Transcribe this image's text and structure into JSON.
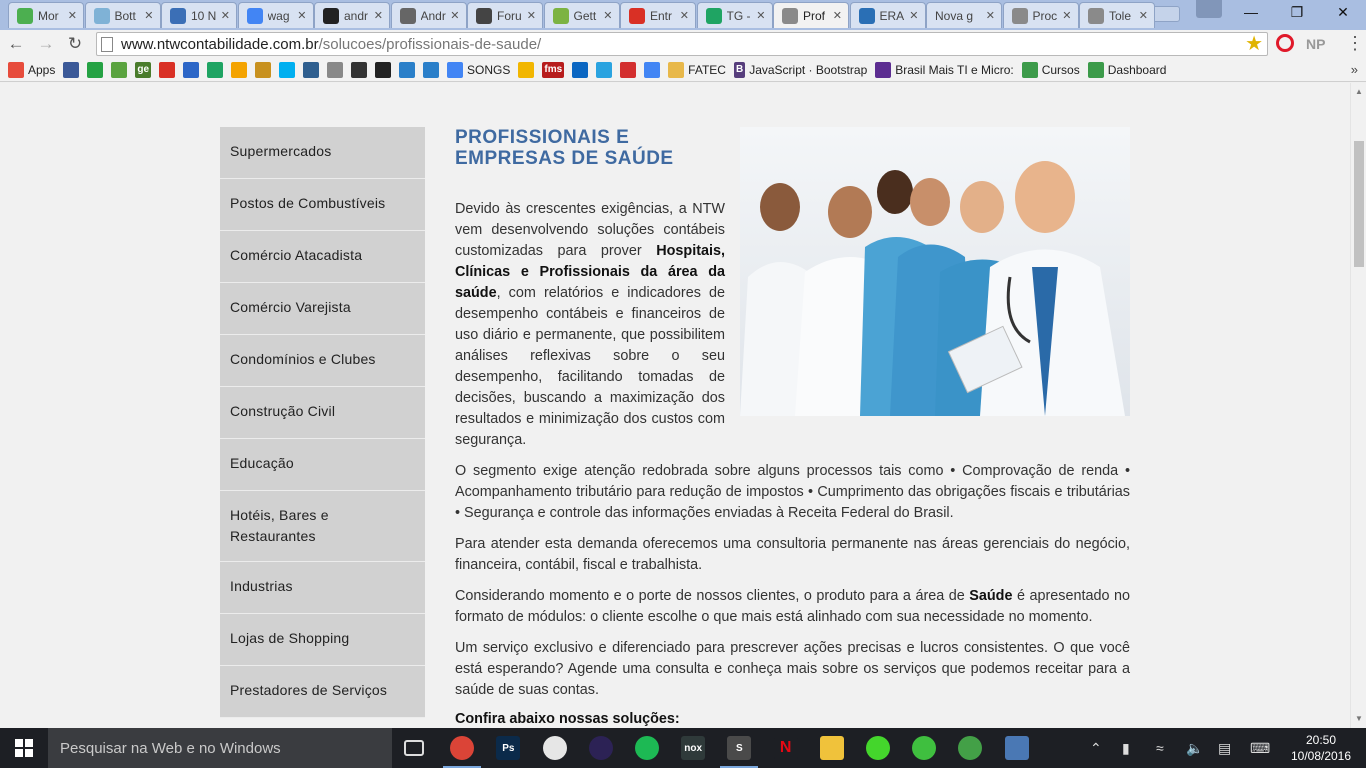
{
  "browser": {
    "tabs": [
      {
        "label": "Mor",
        "icon": "leaf-icon",
        "color": "#4caf50"
      },
      {
        "label": "Bott",
        "icon": "bottle-icon",
        "color": "#7fb2d6"
      },
      {
        "label": "10 N",
        "icon": "photo-icon",
        "color": "#3b6fb6"
      },
      {
        "label": "wag",
        "icon": "google-icon",
        "color": "#4285f4"
      },
      {
        "label": "andr",
        "icon": "github-icon",
        "color": "#222222"
      },
      {
        "label": "Andr",
        "icon": "wikipedia-icon",
        "color": "#666666"
      },
      {
        "label": "Foru",
        "icon": "forum-icon",
        "color": "#444444"
      },
      {
        "label": "Gett",
        "icon": "android-icon",
        "color": "#7cb342"
      },
      {
        "label": "Entr",
        "icon": "gmail-icon",
        "color": "#d93025"
      },
      {
        "label": "TG -",
        "icon": "drive-icon",
        "color": "#1fa463"
      },
      {
        "label": "Prof",
        "icon": "page-icon",
        "color": "#8a8a8a",
        "active": true
      },
      {
        "label": "ERA",
        "icon": "globe-icon",
        "color": "#2a6fb5"
      },
      {
        "label": "Nova g",
        "icon": "none",
        "color": "#d8e2f2"
      },
      {
        "label": "Proc",
        "icon": "page-icon",
        "color": "#8a8a8a"
      },
      {
        "label": "Tole",
        "icon": "page-icon",
        "color": "#8a8a8a"
      }
    ],
    "window_controls": {
      "minimize": "—",
      "maximize": "❐",
      "close": "✕"
    },
    "address": {
      "host": "www.ntwcontabilidade.com.br",
      "path": "/solucoes/profissionais-de-saude/"
    },
    "extensions": {
      "np_label": "NP"
    },
    "bookmarks": [
      {
        "label": "Apps",
        "icon": "apps-grid-icon",
        "color": "#e74c3c"
      },
      {
        "label": "",
        "icon": "facebook-icon",
        "color": "#3b5998"
      },
      {
        "label": "",
        "icon": "whatsapp-icon",
        "color": "#25a244"
      },
      {
        "label": "",
        "icon": "evernote-icon",
        "color": "#5aa33f"
      },
      {
        "label": "",
        "icon": "ge-icon",
        "color": "#4a7c2c",
        "glyph": "ge"
      },
      {
        "label": "",
        "icon": "gmail-icon",
        "color": "#d93025"
      },
      {
        "label": "",
        "icon": "mail-icon",
        "color": "#2c66c7"
      },
      {
        "label": "",
        "icon": "drive-icon",
        "color": "#1fa463"
      },
      {
        "label": "",
        "icon": "pinwheel-icon",
        "color": "#f4a300"
      },
      {
        "label": "",
        "icon": "lock-icon",
        "color": "#c8911f"
      },
      {
        "label": "",
        "icon": "skype-icon",
        "color": "#00aff0"
      },
      {
        "label": "",
        "icon": "photo-icon",
        "color": "#2f5f8f"
      },
      {
        "label": "",
        "icon": "bug-icon",
        "color": "#888888"
      },
      {
        "label": "",
        "icon": "chart-icon",
        "color": "#333333"
      },
      {
        "label": "",
        "icon": "git-icon",
        "color": "#222222"
      },
      {
        "label": "",
        "icon": "cloud-download-icon",
        "color": "#2a7fc9"
      },
      {
        "label": "",
        "icon": "download-icon",
        "color": "#2a7fc9"
      },
      {
        "label": "SONGS",
        "icon": "docs-icon",
        "color": "#4285f4"
      },
      {
        "label": "",
        "icon": "sun-icon",
        "color": "#f2b600"
      },
      {
        "label": "",
        "icon": "fms-icon",
        "color": "#b71c1c",
        "glyph": "fms"
      },
      {
        "label": "",
        "icon": "linkedin-icon",
        "color": "#0a66c2"
      },
      {
        "label": "",
        "icon": "play-icon",
        "color": "#2aa3e0"
      },
      {
        "label": "",
        "icon": "yahoo-icon",
        "color": "#d32f2f"
      },
      {
        "label": "",
        "icon": "translate-icon",
        "color": "#4285f4"
      },
      {
        "label": "FATEC",
        "icon": "folder-icon",
        "color": "#e8b84a"
      },
      {
        "label": "JavaScript · Bootstrap",
        "icon": "bootstrap-icon",
        "color": "#563d7c",
        "glyph": "B"
      },
      {
        "label": "Brasil Mais TI e Micro:",
        "icon": "microsoft-icon",
        "color": "#5c2d91"
      },
      {
        "label": "Cursos",
        "icon": "people-icon",
        "color": "#3c9b4a"
      },
      {
        "label": "Dashboard",
        "icon": "people-icon",
        "color": "#3c9b4a"
      }
    ],
    "bookmarks_more": "»"
  },
  "sidebar": {
    "items": [
      {
        "label": "Supermercados"
      },
      {
        "label": "Postos de Combustíveis"
      },
      {
        "label": "Comércio Atacadista"
      },
      {
        "label": "Comércio Varejista"
      },
      {
        "label": "Condomínios e Clubes"
      },
      {
        "label": "Construção Civil"
      },
      {
        "label": "Educação"
      },
      {
        "label": "Hotéis, Bares e Restaurantes"
      },
      {
        "label": "Industrias"
      },
      {
        "label": "Lojas de Shopping"
      },
      {
        "label": "Prestadores de Serviços"
      }
    ]
  },
  "main": {
    "title": "PROFISSIONAIS E EMPRESAS DE SAÚDE",
    "intro_before": "Devido às crescentes exigências, a NTW vem desenvolvendo soluções contábeis customizadas para prover ",
    "intro_bold": "Hospitais, Clínicas e Profissionais da área da saúde",
    "intro_after": ", com relatórios e indicadores de desempenho contábeis e financeiros de uso diário e permanente, que possibilitem análises reflexivas sobre o seu desempenho, facilitando tomadas de decisões, buscando a maximização dos resultados e minimização dos custos com segurança.",
    "para1": "O segmento exige atenção redobrada sobre alguns processos tais como • Comprovação de renda • Acompanhamento tributário para redução de impostos • Cumprimento das obrigações fiscais e tributárias • Segurança e controle das informações enviadas à Receita Federal do Brasil.",
    "para2": "Para atender esta demanda oferecemos uma consultoria permanente nas áreas gerenciais do negócio, financeira, contábil, fiscal e trabalhista.",
    "para3_before": "Considerando momento e o porte de nossos clientes, o produto para a área de ",
    "para3_bold": "Saúde",
    "para3_after": " é apresentado no formato de módulos:  o cliente escolhe o que mais está alinhado com sua necessidade no momento.",
    "para4": "Um serviço exclusivo e diferenciado para prescrever ações precisas e lucros consistentes. O que você está esperando? Agende uma consulta e conheça mais sobre os serviços que podemos receitar para a saúde de suas contas.",
    "confira": "Confira abaixo nossas soluções:"
  },
  "taskbar": {
    "search_placeholder": "Pesquisar na Web e no Windows",
    "apps": [
      {
        "icon": "task-view-icon",
        "color": "#1d1f24"
      },
      {
        "icon": "chrome-icon",
        "color": "#db4437",
        "active": true
      },
      {
        "icon": "photoshop-icon",
        "color": "#0b2a4a",
        "glyph": "Ps"
      },
      {
        "icon": "itunes-icon",
        "color": "#e6e6e6"
      },
      {
        "icon": "eclipse-icon",
        "color": "#2c2255"
      },
      {
        "icon": "spotify-icon",
        "color": "#1db954"
      },
      {
        "icon": "nox-icon",
        "color": "#2f3a3a",
        "glyph": "nox"
      },
      {
        "icon": "sublime-icon",
        "color": "#4a4a4a",
        "glyph": "S",
        "active": true
      },
      {
        "icon": "netflix-icon",
        "color": "#1d1f24",
        "glyph": "N"
      },
      {
        "icon": "file-explorer-icon",
        "color": "#f0c23b"
      },
      {
        "icon": "razer-icon",
        "color": "#44d62c"
      },
      {
        "icon": "wifi-hotspot-icon",
        "color": "#3fbf3f"
      },
      {
        "icon": "utorrent-icon",
        "color": "#43a047"
      },
      {
        "icon": "virtualbox-icon",
        "color": "#4a78b4"
      }
    ],
    "time": "20:50",
    "date": "10/08/2016"
  }
}
